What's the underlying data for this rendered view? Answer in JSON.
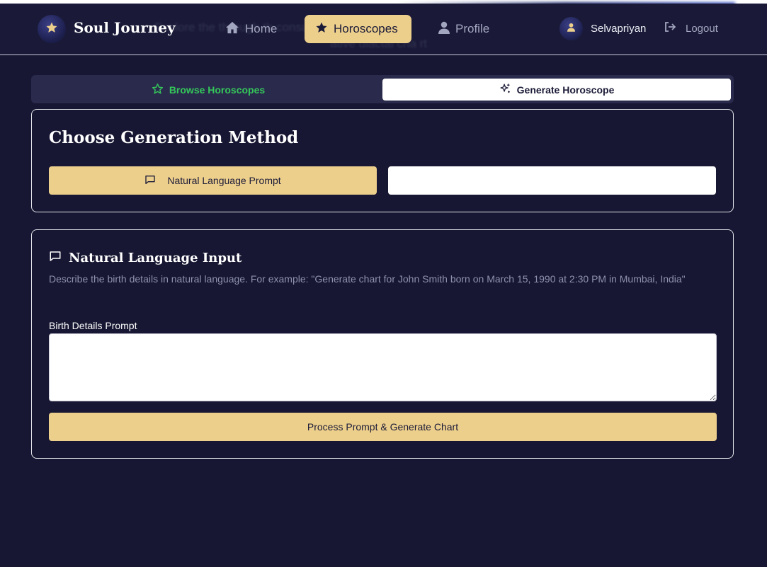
{
  "header": {
    "brand": "Soul Journey",
    "nav": [
      {
        "label": "Home",
        "icon": "home-icon"
      },
      {
        "label": "Horoscopes",
        "icon": "star-icon",
        "active": true
      },
      {
        "label": "Profile",
        "icon": "user-icon"
      }
    ],
    "user": {
      "name": "Selvapriyan",
      "icon": "user-icon"
    },
    "logout_label": "Logout",
    "ghost_line1": "Explore the          through th                                                  consult          spes or gene",
    "ghost_line2": "ative    diactal cha rt"
  },
  "tabs": {
    "browse_label": "Browse Horoscopes",
    "generate_label": "Generate Horoscope",
    "active": "generate"
  },
  "method_card": {
    "title": "Choose Generation Method",
    "option_nl_label": "Natural Language Prompt",
    "option_form_label": ""
  },
  "input_card": {
    "title": "Natural Language Input",
    "description": "Describe the birth details in natural language. For example: \"Generate chart for John Smith born on March 15, 1990 at 2:30 PM in Mumbai, India\"",
    "field_label": "Birth Details Prompt",
    "field_value": "",
    "submit_label": "Process Prompt & Generate Chart"
  },
  "colors": {
    "background": "#171733",
    "accent": "#edcf8c",
    "success": "#34c759"
  }
}
